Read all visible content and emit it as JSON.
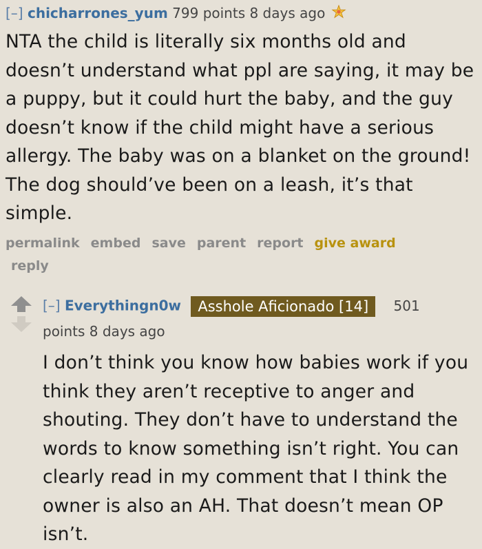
{
  "comment1": {
    "toggle": "[–]",
    "author": "chicharrones_yum",
    "meta": "799 points 8 days ago",
    "award_icon": "award-icon",
    "body": "NTA the child is literally six months old and doesn’t understand what ppl are saying, it may be a puppy, but it could hurt the baby, and the guy doesn’t know if the child might have a serious allergy. The baby was on a blanket on the ground! The dog should’ve been on a leash, it’s that simple.",
    "buttons": {
      "permalink": "permalink",
      "embed": "embed",
      "save": "save",
      "parent": "parent",
      "report": "report",
      "give_award": "give award",
      "reply": "reply"
    }
  },
  "comment2": {
    "toggle": "[–]",
    "author": "Everythingn0w",
    "flair": "Asshole Aficionado [14]",
    "score_num": "501",
    "meta": "points 8 days ago",
    "body": "I don’t think you know how babies work if you think they aren’t receptive to anger and shouting. They don’t have to understand the words to know something isn’t right. You can clearly read in my comment that I think the owner is also an AH. That doesn’t mean OP isn’t."
  },
  "colors": {
    "background": "#e6e1d7",
    "author": "#3c6e9f",
    "flair_bg": "#6f5a1f",
    "gold": "#b8920f"
  }
}
